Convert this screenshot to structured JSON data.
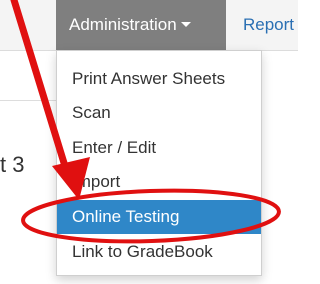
{
  "navbar": {
    "admin_label": "Administration",
    "reports_label": "Report"
  },
  "heading_fragment": "t 3",
  "menu": {
    "items": [
      {
        "label": "Print Answer Sheets",
        "active": false
      },
      {
        "label": "Scan",
        "active": false
      },
      {
        "label": "Enter / Edit",
        "active": false
      },
      {
        "label": "Import",
        "active": false
      },
      {
        "label": "Online Testing",
        "active": true
      },
      {
        "label": "Link to GradeBook",
        "active": false
      }
    ]
  },
  "colors": {
    "navbar_bg": "#f4f4f4",
    "admin_bg": "#7f7f7f",
    "active_item_bg": "#2f87c8",
    "annotation_red": "#e01010",
    "reports_link": "#2a6fb3"
  },
  "annotation": {
    "arrow": "red-arrow-icon",
    "circle": "red-circle-highlight"
  }
}
